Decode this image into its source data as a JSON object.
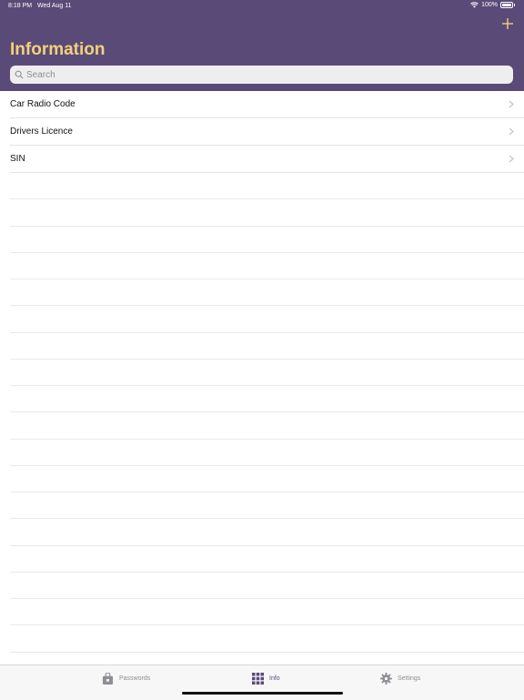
{
  "status_bar": {
    "time": "8:18 PM",
    "date": "Wed Aug 11",
    "battery": "100%"
  },
  "header": {
    "title": "Information",
    "add_icon": "plus-icon",
    "accent": "#f3d17a",
    "background": "#5a4a78"
  },
  "search": {
    "placeholder": "Search",
    "value": ""
  },
  "list": {
    "items": [
      {
        "label": "Car Radio Code"
      },
      {
        "label": "Drivers Licence"
      },
      {
        "label": "SIN"
      }
    ]
  },
  "tab_bar": {
    "tabs": [
      {
        "label": "Passwords",
        "icon": "lock-box-icon",
        "active": false
      },
      {
        "label": "Info",
        "icon": "grid-icon",
        "active": true
      },
      {
        "label": "Settings",
        "icon": "gear-icon",
        "active": false
      }
    ]
  }
}
